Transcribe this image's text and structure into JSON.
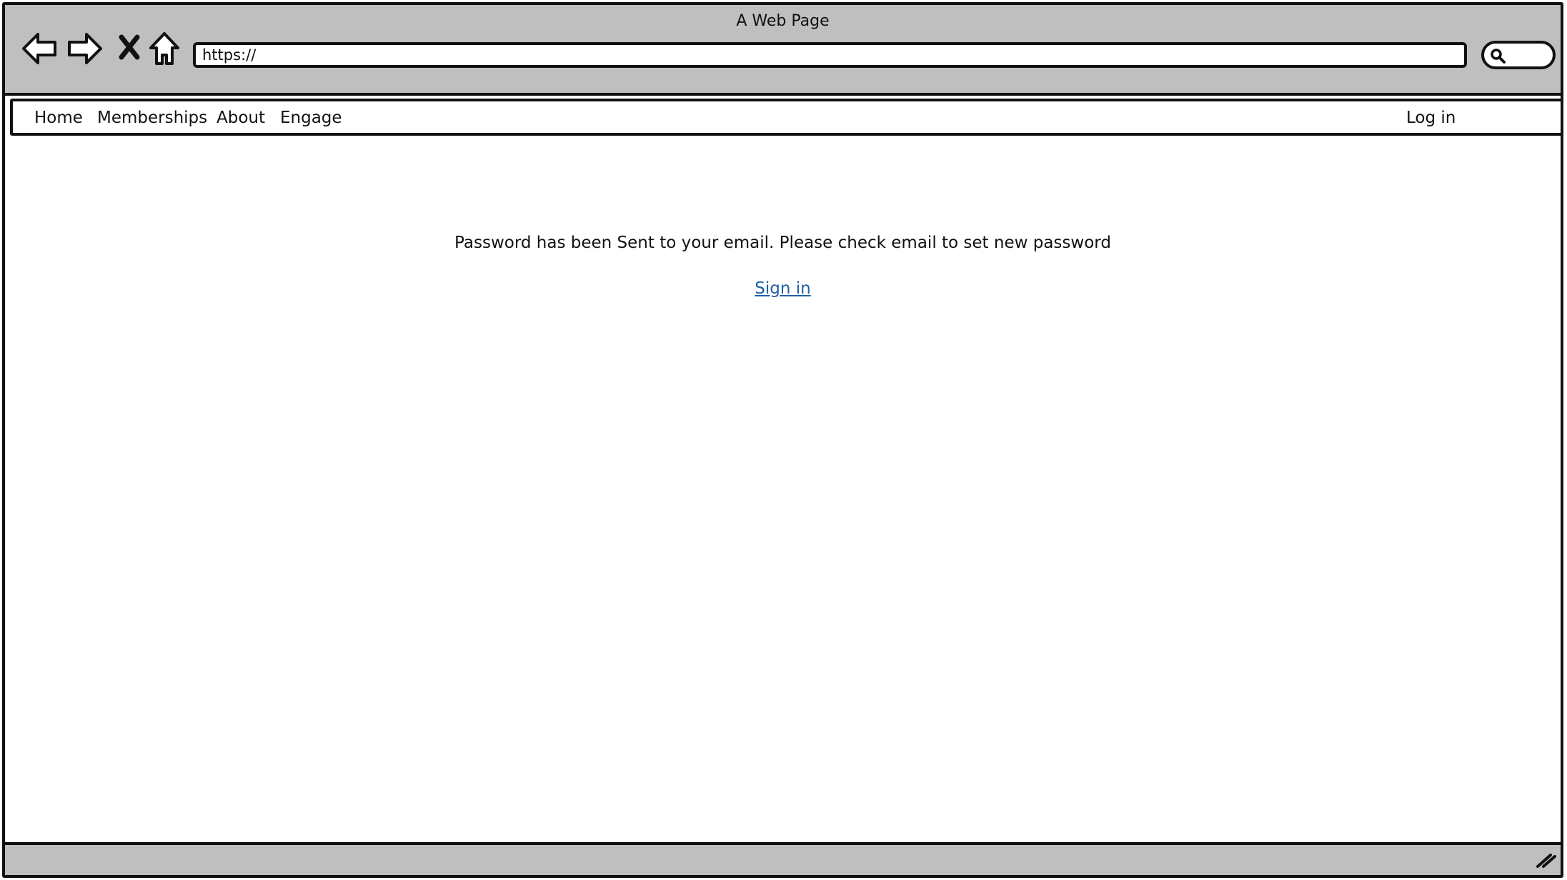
{
  "browser": {
    "window_title": "A Web Page",
    "url": "https://",
    "icons": [
      "back-arrow-icon",
      "forward-arrow-icon",
      "stop-icon",
      "home-icon",
      "search-icon",
      "resize-grip-icon"
    ]
  },
  "site_nav": {
    "items": [
      "Home",
      "Memberships",
      "About",
      "Engage"
    ],
    "login_label": "Log in"
  },
  "main": {
    "message": "Password has been Sent to your email. Please check email to set new password",
    "signin_label": "Sign in"
  },
  "colors": {
    "chrome_gray": "#bfbfbf",
    "link_blue": "#1f5fa8",
    "outline": "#111111"
  }
}
